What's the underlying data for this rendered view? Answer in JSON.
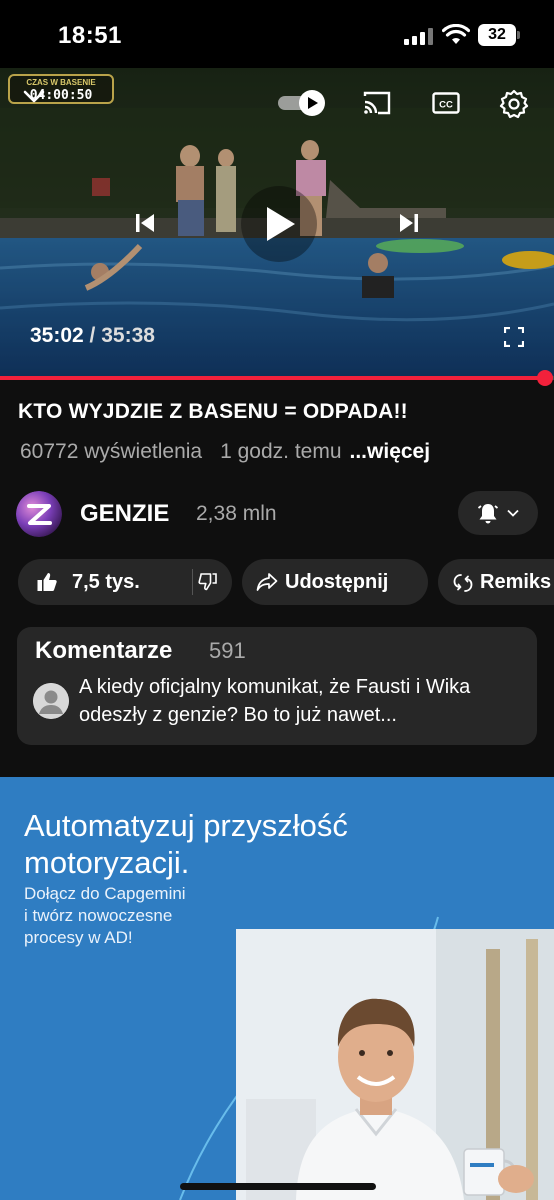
{
  "status_bar": {
    "time": "18:51",
    "battery": "32"
  },
  "player": {
    "overlay_badge_title": "CZAS W BASENIE",
    "overlay_badge_timer": "04:00:50",
    "current_time": "35:02",
    "separator": " / ",
    "duration": "35:38",
    "progress_fraction": 0.983,
    "accent_color": "#f2213b"
  },
  "video": {
    "title": "KTO WYJDZIE Z BASENU = ODPADA!!",
    "views": "60772 wyświetlenia",
    "uploaded": "1 godz. temu",
    "more_label": "...więcej"
  },
  "channel": {
    "name": "GENZIE",
    "subscribers": "2,38 mln"
  },
  "actions": {
    "like_count": "7,5 tys.",
    "share_label": "Udostępnij",
    "remix_label": "Remiks"
  },
  "comments": {
    "title": "Komentarze",
    "count": "591",
    "top_comment": "A kiedy oficjalny komunikat, że Fausti i Wika odeszły z genzie? Bo to już nawet..."
  },
  "ad": {
    "headline_line1": "Automatyzuj przyszłość",
    "headline_line2": "motoryzacji.",
    "sub_line1": "Dołącz do Capgemini",
    "sub_line2": "i twórz nowoczesne",
    "sub_line3": "procesy w AD!",
    "background_color": "#2f7dc2"
  },
  "icons": [
    "signal-icon",
    "wifi-icon",
    "battery-icon",
    "chevron-down-icon",
    "autoplay-toggle-icon",
    "cast-icon",
    "captions-icon",
    "settings-gear-icon",
    "previous-icon",
    "play-icon",
    "next-icon",
    "fullscreen-icon",
    "bell-icon",
    "thumb-up-icon",
    "thumb-down-icon",
    "share-icon",
    "remix-icon",
    "user-avatar-icon"
  ]
}
